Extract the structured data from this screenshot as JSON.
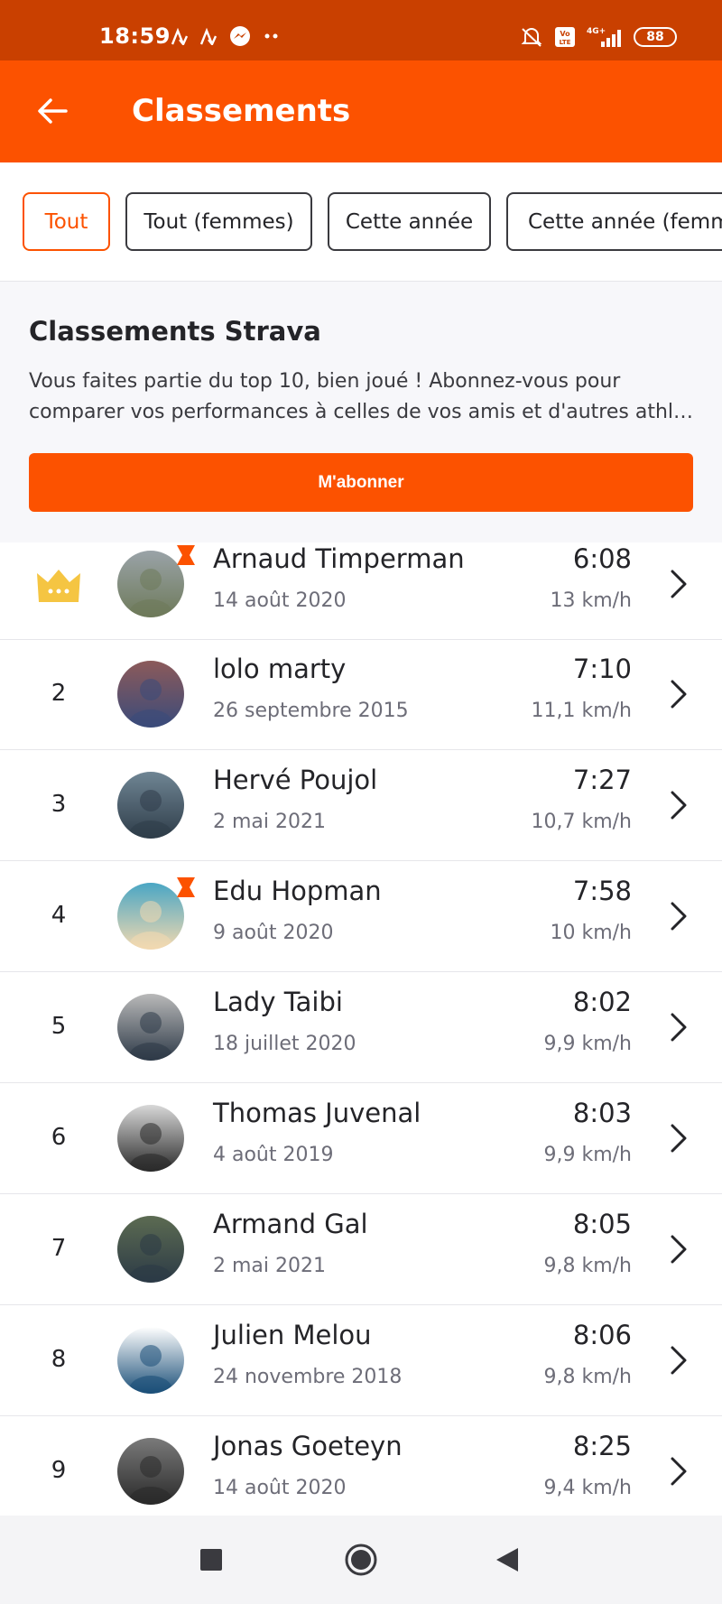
{
  "status_bar": {
    "time": "18:59",
    "battery": "88",
    "network": "4G+",
    "volte": "Vo LTE"
  },
  "header": {
    "title": "Classements"
  },
  "filters": [
    {
      "label": "Tout",
      "active": true
    },
    {
      "label": "Tout (femmes)",
      "active": false
    },
    {
      "label": "Cette année",
      "active": false
    },
    {
      "label": "Cette année (femmes)",
      "active": false
    }
  ],
  "promo": {
    "title": "Classements Strava",
    "description": "Vous faites partie du top 10, bien joué ! Abonnez-vous pour comparer vos performances à celles de vos amis et d'autres athl…",
    "button_label": "M'abonner"
  },
  "leaderboard": [
    {
      "rank": "",
      "is_crown": true,
      "name": "Arnaud Timperman",
      "date": "14 août 2020",
      "time": "6:08",
      "speed": "13 km/h"
    },
    {
      "rank": "2",
      "is_crown": false,
      "name": "lolo marty",
      "date": "26 septembre 2015",
      "time": "7:10",
      "speed": "11,1 km/h"
    },
    {
      "rank": "3",
      "is_crown": false,
      "name": "Hervé Poujol",
      "date": "2 mai 2021",
      "time": "7:27",
      "speed": "10,7 km/h"
    },
    {
      "rank": "4",
      "is_crown": false,
      "name": "Edu Hopman",
      "date": "9 août 2020",
      "time": "7:58",
      "speed": "10 km/h"
    },
    {
      "rank": "5",
      "is_crown": false,
      "name": "Lady Taibi",
      "date": "18 juillet 2020",
      "time": "8:02",
      "speed": "9,9 km/h"
    },
    {
      "rank": "6",
      "is_crown": false,
      "name": "Thomas Juvenal",
      "date": "4 août 2019",
      "time": "8:03",
      "speed": "9,9 km/h"
    },
    {
      "rank": "7",
      "is_crown": false,
      "name": "Armand Gal",
      "date": "2 mai 2021",
      "time": "8:05",
      "speed": "9,8 km/h"
    },
    {
      "rank": "8",
      "is_crown": false,
      "name": "Julien Melou",
      "date": "24 novembre 2018",
      "time": "8:06",
      "speed": "9,8 km/h"
    },
    {
      "rank": "9",
      "is_crown": false,
      "name": "Jonas Goeteyn",
      "date": "14 août 2020",
      "time": "8:25",
      "speed": "9,4 km/h"
    }
  ],
  "colors": {
    "brand": "#fc5200",
    "status_bar": "#c94000",
    "crown": "#f5c542"
  }
}
